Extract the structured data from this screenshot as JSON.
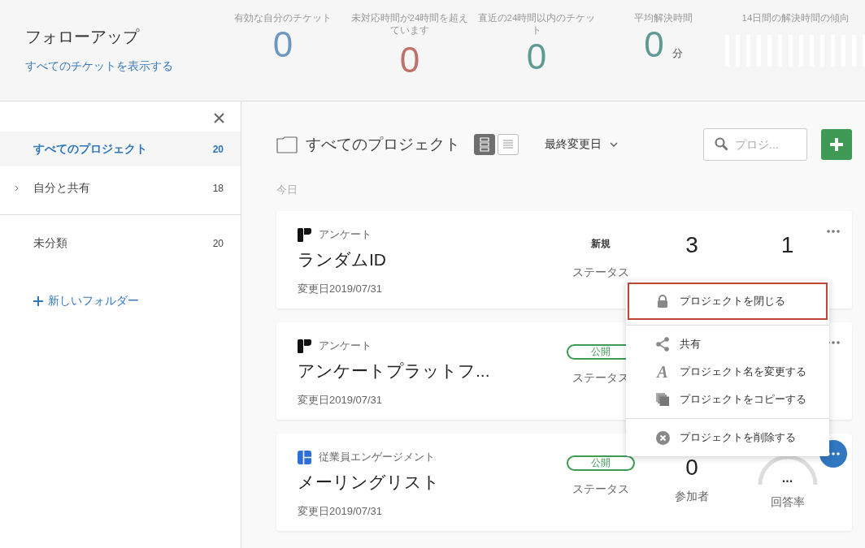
{
  "header": {
    "title": "フォローアップ",
    "link": "すべてのチケットを表示する",
    "metrics": [
      {
        "label": "有効な自分のチケット",
        "value": "0",
        "color": "#6d97bd"
      },
      {
        "label": "未対応時間が24時間を超えています",
        "value": "0",
        "color": "#c0706a"
      },
      {
        "label": "直近の24時間以内のチケット",
        "value": "0",
        "color": "#5f9a94"
      },
      {
        "label": "平均解決時間",
        "value": "0",
        "unit": "分",
        "color": "#5f9a94"
      }
    ],
    "trend": {
      "label": "14日間の解決時間の傾向"
    }
  },
  "sidebar": {
    "items": [
      {
        "label": "すべてのプロジェクト",
        "count": "20",
        "selected": true,
        "expandable": false
      },
      {
        "label": "自分と共有",
        "count": "18",
        "selected": false,
        "expandable": true
      },
      {
        "label": "未分類",
        "count": "20",
        "selected": false,
        "expandable": false
      }
    ],
    "new_folder": "新しいフォルダー"
  },
  "toolbar": {
    "title": "すべてのプロジェクト",
    "views": [
      {
        "kind": "cards",
        "selected": true
      },
      {
        "kind": "list",
        "selected": false
      }
    ],
    "sort": "最終変更日",
    "search": {
      "placeholder": "プロジ..."
    }
  },
  "section": "今日",
  "projects": [
    {
      "type": "アンケート",
      "kind": "survey",
      "name": "ランダムID",
      "modified": "変更日2019/07/31",
      "status": {
        "kind": "text",
        "label": "新規"
      },
      "status_label": "ステータス",
      "stats": [
        {
          "kind": "number",
          "value": "3"
        },
        {
          "kind": "number",
          "value": "1"
        }
      ],
      "menu_open": false
    },
    {
      "type": "アンケート",
      "kind": "survey",
      "name": "アンケートプラットフ...",
      "modified": "変更日2019/07/31",
      "status": {
        "kind": "badge",
        "label": "公開"
      },
      "status_label": "ステータス",
      "menu_open": false
    },
    {
      "type": "従業員エンゲージメント",
      "kind": "engagement",
      "name": "メーリングリスト",
      "modified": "変更日2019/07/31",
      "status": {
        "kind": "badge",
        "label": "公開"
      },
      "status_label": "ステータス",
      "stats": [
        {
          "kind": "number",
          "value": "0",
          "label": "参加者"
        },
        {
          "kind": "gauge",
          "value": "...",
          "label": "回答率"
        }
      ],
      "menu_open": true
    }
  ],
  "menu": {
    "groups": [
      [
        {
          "label": "プロジェクトを閉じる",
          "selected": true
        }
      ],
      [
        {
          "label": "共有",
          "selected": false
        },
        {
          "label": "プロジェクト名を変更する",
          "icon_text": "A",
          "selected": false
        },
        {
          "label": "プロジェクトをコピーする",
          "selected": false
        }
      ],
      [
        {
          "label": "プロジェクトを削除する",
          "selected": false
        }
      ]
    ]
  }
}
